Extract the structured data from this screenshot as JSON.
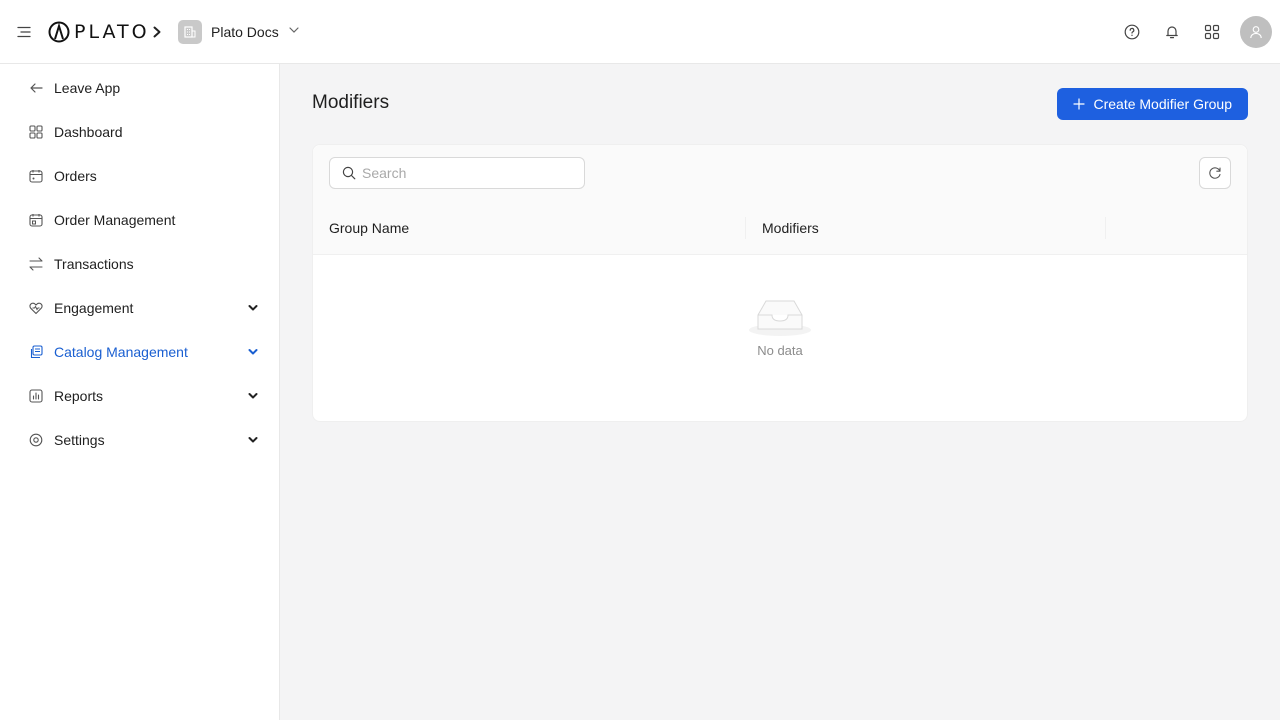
{
  "header": {
    "logo_text": "PLATO",
    "workspace_name": "Plato Docs"
  },
  "sidebar": {
    "items": [
      {
        "label": "Leave App",
        "icon": "arrow-left-icon"
      },
      {
        "label": "Dashboard",
        "icon": "dashboard-icon"
      },
      {
        "label": "Orders",
        "icon": "orders-icon"
      },
      {
        "label": "Order Management",
        "icon": "order-management-icon"
      },
      {
        "label": "Transactions",
        "icon": "transactions-icon"
      },
      {
        "label": "Engagement",
        "icon": "heart-icon",
        "expandable": true
      },
      {
        "label": "Catalog Management",
        "icon": "catalog-icon",
        "expandable": true,
        "active": true
      },
      {
        "label": "Reports",
        "icon": "reports-icon",
        "expandable": true
      },
      {
        "label": "Settings",
        "icon": "settings-icon",
        "expandable": true
      }
    ]
  },
  "main": {
    "title": "Modifiers",
    "create_button_label": "Create Modifier Group",
    "search_placeholder": "Search",
    "columns": [
      "Group Name",
      "Modifiers",
      ""
    ],
    "empty_text": "No data"
  },
  "colors": {
    "accent": "#1e60e0",
    "active_text": "#1a5fd1"
  }
}
